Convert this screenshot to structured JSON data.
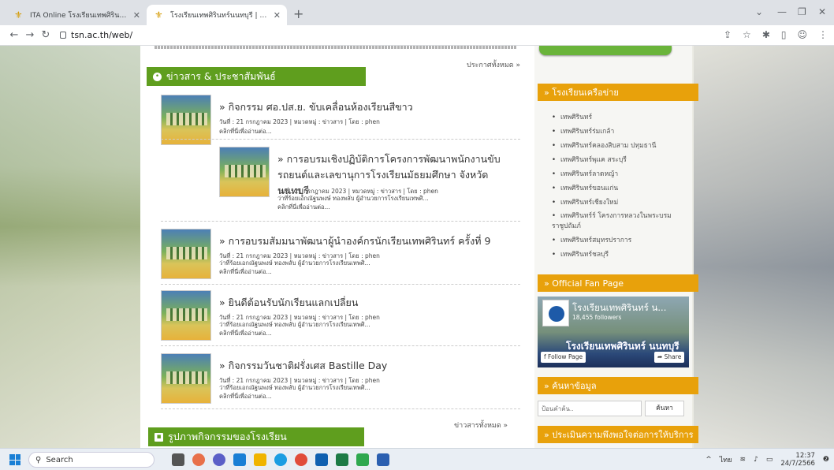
{
  "browser": {
    "tabs": [
      {
        "title": "ITA Online โรงเรียนเทพศิรินทร์นนทบุรี",
        "active": false
      },
      {
        "title": "โรงเรียนเทพศิรินทร์นนทบุรี | Debsirin",
        "active": true
      }
    ],
    "url": "tsn.ac.th/web/"
  },
  "news": {
    "all_link": "ประกาศทั้งหมด »",
    "section_title": "ข่าวสาร & ประชาสัมพันธ์",
    "items": [
      {
        "title": "» กิจกรรม ศอ.ปส.ย. ขับเคลื่อนห้องเรียนสีขาว",
        "meta": "วันที่ : 21 กรกฎาคม 2023 | หมวดหมู่ : ข่าวสาร | โดย : phen",
        "excerpt": "",
        "read": "คลิกที่นี่เพื่ออ่านต่อ..."
      },
      {
        "title": "» การอบรมเชิงปฏิบัติการโครงการพัฒนาพนักงานขับรถยนต์และเลขานุการโรงเรียนมัธยมศึกษา จังหวัดนนทบุรี",
        "meta": "วันที่ : 21 กรกฎาคม 2023 | หมวดหมู่ : ข่าวสาร | โดย : phen",
        "excerpt": "ว่าที่ร้อยเอกณัฐนพงษ์ ทองพลับ ผู้อำนวยการโรงเรียนเทพศิ...",
        "read": "คลิกที่นี่เพื่ออ่านต่อ..."
      },
      {
        "title": "» การอบรมสัมมนาพัฒนาผู้นำองค์กรนักเรียนเทพศิรินทร์ ครั้งที่ 9",
        "meta": "วันที่ : 21 กรกฎาคม 2023 | หมวดหมู่ : ข่าวสาร | โดย : phen",
        "excerpt": "ว่าที่ร้อยเอกณัฐนพงษ์ ทองพลับ ผู้อำนวยการโรงเรียนเทพศิ...",
        "read": "คลิกที่นี่เพื่ออ่านต่อ..."
      },
      {
        "title": "» ยินดีต้อนรับนักเรียนแลกเปลี่ยน",
        "meta": "วันที่ : 21 กรกฎาคม 2023 | หมวดหมู่ : ข่าวสาร | โดย : phen",
        "excerpt": "ว่าที่ร้อยเอกณัฐนพงษ์ ทองพลับ ผู้อำนวยการโรงเรียนเทพศิ...",
        "read": "คลิกที่นี่เพื่ออ่านต่อ..."
      },
      {
        "title": "» กิจกรรมวันชาติฝรั่งเศส Bastille Day",
        "meta": "วันที่ : 21 กรกฎาคม 2023 | หมวดหมู่ : ข่าวสาร | โดย : phen",
        "excerpt": "ว่าที่ร้อยเอกณัฐนพงษ์ ทองพลับ ผู้อำนวยการโรงเรียนเทพศิ...",
        "read": "คลิกที่นี่เพื่ออ่านต่อ..."
      }
    ],
    "all_news_link": "ข่าวสารทั้งหมด »",
    "gallery_title": "รูปภาพกิจกรรมของโรงเรียน"
  },
  "sidebar": {
    "network_title": "» โรงเรียนเครือข่าย",
    "network_links": [
      "เทพศิรินทร์",
      "เทพศิรินทร์ร่มเกล้า",
      "เทพศิรินทร์คลองสิบสาม ปทุมธานี",
      "เทพศิรินทร์พุแค สระบุรี",
      "เทพศิรินทร์ลาดหญ้า",
      "เทพศิรินทร์ขอนแก่น",
      "เทพศิรินทร์เชียงใหม่",
      "เทพศิรินทร์ร์ โครงการหลวงในพระบรมราชูปถัมภ์",
      "เทพศิรินทร์สมุทรปราการ",
      "เทพศิรินทร์ชลบุรี"
    ],
    "fanpage_title": "» Official Fan Page",
    "fanpage": {
      "name": "โรงเรียนเทพศิรินทร์ น...",
      "followers": "18,455 followers",
      "cover_text": "โรงเรียนเทพศิรินทร์ นนทบุรี",
      "follow_label": "Follow Page",
      "share_label": "Share"
    },
    "search_title": "» ค้นหาข้อมูล",
    "search_placeholder": "ป้อนคำค้น..",
    "search_button": "ค้นหา",
    "survey_title": "» ประเมินความพึงพอใจต่อการให้บริการ"
  },
  "taskbar": {
    "search_label": "Search",
    "lang": "ไทย",
    "time": "12:37",
    "date": "24/7/2566"
  }
}
